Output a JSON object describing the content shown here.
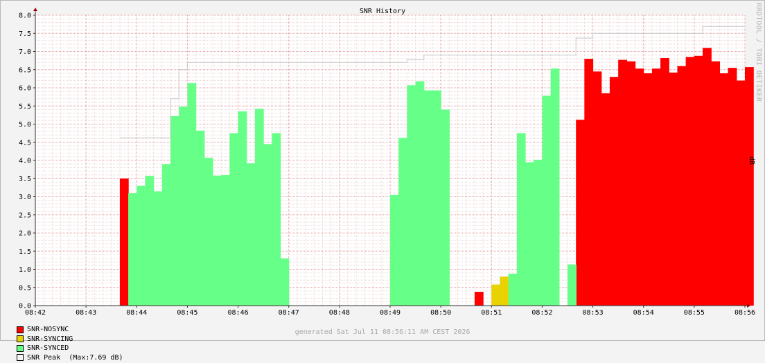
{
  "chart_data": {
    "type": "bar",
    "title": "SNR History",
    "ylabel": "dB",
    "ylim": [
      0,
      8
    ],
    "y_ticks": [
      "0.0",
      "0.5",
      "1.0",
      "1.5",
      "2.0",
      "2.5",
      "3.0",
      "3.5",
      "4.0",
      "4.5",
      "5.0",
      "5.5",
      "6.0",
      "6.5",
      "7.0",
      "7.5",
      "8.0"
    ],
    "x_ticks": [
      "08:42",
      "08:43",
      "08:44",
      "08:45",
      "08:46",
      "08:47",
      "08:48",
      "08:49",
      "08:50",
      "08:51",
      "08:52",
      "08:53",
      "08:54",
      "08:55",
      "08:56"
    ],
    "x_unit": "minutes after 08:42",
    "bin_minutes": 0.1667,
    "grid": true,
    "series": [
      {
        "name": "SNR-NOSYNC",
        "color": "#ff0000",
        "bars": [
          [
            1.667,
            3.5
          ],
          [
            8.667,
            0.38
          ],
          [
            10.667,
            5.12
          ],
          [
            10.833,
            6.8
          ],
          [
            11.0,
            6.45
          ],
          [
            11.167,
            5.85
          ],
          [
            11.333,
            6.3
          ],
          [
            11.5,
            6.77
          ],
          [
            11.667,
            6.73
          ],
          [
            11.833,
            6.53
          ],
          [
            12.0,
            6.4
          ],
          [
            12.167,
            6.53
          ],
          [
            12.333,
            6.82
          ],
          [
            12.5,
            6.42
          ],
          [
            12.667,
            6.6
          ],
          [
            12.833,
            6.85
          ],
          [
            13.0,
            6.88
          ],
          [
            13.167,
            7.1
          ],
          [
            13.333,
            6.73
          ],
          [
            13.5,
            6.4
          ],
          [
            13.667,
            6.55
          ],
          [
            13.833,
            6.2
          ],
          [
            14.0,
            6.57
          ]
        ]
      },
      {
        "name": "SNR-SYNCING",
        "color": "#e8d200",
        "bars": [
          [
            9.0,
            0.58
          ],
          [
            9.167,
            0.8
          ]
        ]
      },
      {
        "name": "SNR-SYNCED",
        "color": "#66ff88",
        "bars": [
          [
            1.833,
            3.1
          ],
          [
            2.0,
            3.3
          ],
          [
            2.167,
            3.57
          ],
          [
            2.333,
            3.15
          ],
          [
            2.5,
            3.9
          ],
          [
            2.667,
            5.22
          ],
          [
            2.833,
            5.48
          ],
          [
            3.0,
            6.13
          ],
          [
            3.167,
            4.82
          ],
          [
            3.333,
            4.07
          ],
          [
            3.5,
            3.58
          ],
          [
            3.667,
            3.6
          ],
          [
            3.833,
            4.75
          ],
          [
            4.0,
            5.35
          ],
          [
            4.167,
            3.92
          ],
          [
            4.333,
            5.42
          ],
          [
            4.5,
            4.45
          ],
          [
            4.667,
            4.75
          ],
          [
            4.833,
            1.3
          ],
          [
            7.0,
            3.05
          ],
          [
            7.167,
            4.62
          ],
          [
            7.333,
            6.07
          ],
          [
            7.5,
            6.18
          ],
          [
            7.667,
            5.93
          ],
          [
            7.833,
            5.93
          ],
          [
            8.0,
            5.4
          ],
          [
            9.333,
            0.88
          ],
          [
            9.5,
            4.75
          ],
          [
            9.667,
            3.95
          ],
          [
            9.833,
            4.02
          ],
          [
            10.0,
            5.78
          ],
          [
            10.167,
            6.53
          ],
          [
            10.333,
            0.0
          ],
          [
            10.5,
            1.13
          ],
          [
            10.5,
            0.0
          ],
          [
            10.5,
            1.13
          ],
          [
            10.5,
            1.13
          ]
        ]
      },
      {
        "name": "SNR Peak",
        "color": "#c8c8c8",
        "steps": [
          [
            1.667,
            4.62
          ],
          [
            2.667,
            5.7
          ],
          [
            2.833,
            6.5
          ],
          [
            3.0,
            6.7
          ],
          [
            7.333,
            6.77
          ],
          [
            7.667,
            6.9
          ],
          [
            10.667,
            7.37
          ],
          [
            11.0,
            7.5
          ],
          [
            13.167,
            7.69
          ],
          [
            14.0,
            7.69
          ]
        ]
      }
    ],
    "legend": [
      {
        "label": "SNR-NOSYNC",
        "color": "#ff0000"
      },
      {
        "label": "SNR-SYNCING",
        "color": "#e8d200"
      },
      {
        "label": "SNR-SYNCED",
        "color": "#66ff88"
      },
      {
        "label": "SNR Peak  (Max:7.69 dB)",
        "color": "#f3f3f3"
      }
    ],
    "footer": "generated Sat Jul 11 08:56:11 AM CEST 2026",
    "watermark": "RRDTOOL / TOBI OETIKER"
  }
}
